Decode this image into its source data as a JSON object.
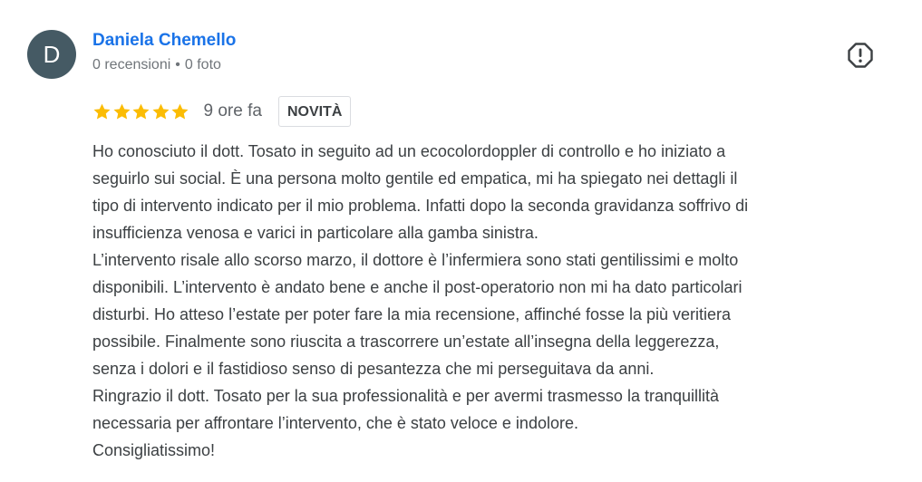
{
  "review": {
    "author": {
      "initial": "D",
      "avatar_color": "#455a64",
      "name": "Daniela Chemello",
      "reviews_count": "0 recensioni",
      "separator": "•",
      "photos_count": "0 foto"
    },
    "report_icon": "report-flag-icon",
    "rating": 5,
    "rating_max": 5,
    "star_color": "#fbbc04",
    "time_ago": "9 ore fa",
    "badge": "NOVITÀ",
    "text_lines": [
      "Ho conosciuto il dott. Tosato in seguito ad un ecocolordoppler di controllo e ho iniziato a",
      "seguirlo sui social. È una persona molto gentile ed empatica, mi ha spiegato nei dettagli il",
      "tipo di intervento indicato per il mio problema. Infatti dopo la seconda gravidanza soffrivo di",
      "insufficienza venosa e varici in particolare alla gamba sinistra.",
      "L’intervento risale allo scorso marzo, il dottore è l’infermiera sono stati gentilissimi e molto",
      "disponibili. L’intervento è andato bene e anche il post-operatorio non mi ha dato particolari",
      "disturbi. Ho atteso l’estate per poter fare la mia recensione, affinché fosse la più veritiera",
      "possibile. Finalmente sono riuscita a trascorrere un’estate all’insegna della leggerezza,",
      "senza i dolori e il fastidioso senso di pesantezza che mi perseguitava da anni.",
      "Ringrazio il dott. Tosato per la sua professionalità e per avermi trasmesso la tranquillità",
      "necessaria per affrontare l’intervento, che è stato veloce e indolore.",
      "Consigliatissimo!"
    ]
  }
}
